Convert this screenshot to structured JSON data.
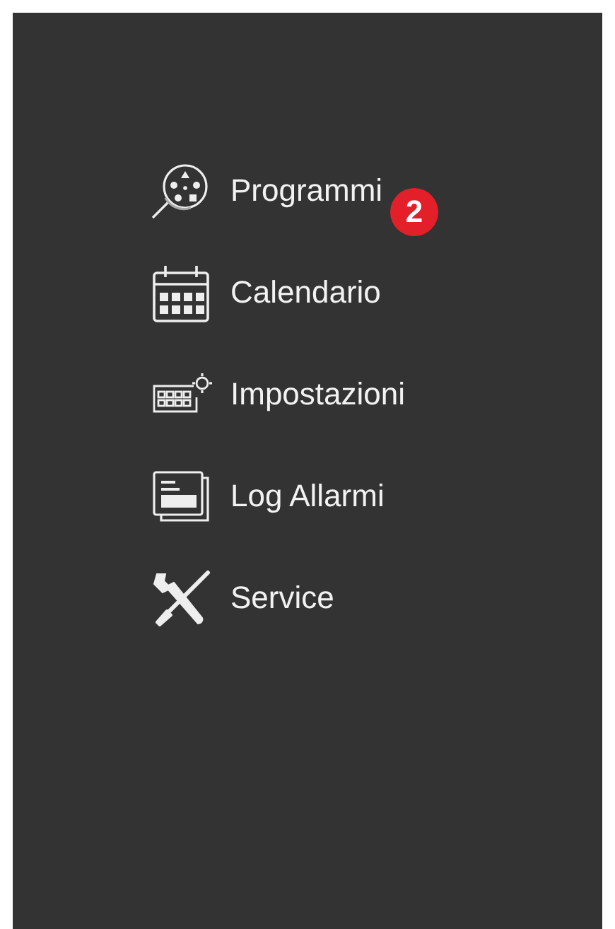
{
  "menu": {
    "items": [
      {
        "kind": "programs",
        "label": "Programmi",
        "badge": "2"
      },
      {
        "kind": "calendar",
        "label": "Calendario"
      },
      {
        "kind": "settings",
        "label": "Impostazioni"
      },
      {
        "kind": "log",
        "label": "Log Allarmi"
      },
      {
        "kind": "service",
        "label": "Service"
      }
    ]
  }
}
